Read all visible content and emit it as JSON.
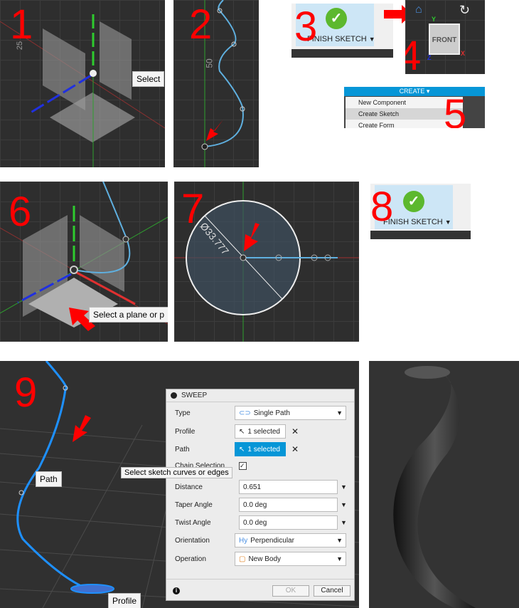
{
  "steps": {
    "s1": {
      "num": "1",
      "tooltip": "Select",
      "dim": "25"
    },
    "s2": {
      "num": "2",
      "dim": "50"
    },
    "s3": {
      "num": "3",
      "finish_label": "FINISH SKETCH",
      "dropdown": "▼"
    },
    "s4": {
      "num": "4",
      "cube_face": "FRONT",
      "axis_y": "Y",
      "axis_x": "X",
      "axis_z": "Z",
      "home_icon": "home-icon"
    },
    "s5": {
      "num": "5",
      "menu_title": "CREATE ▾",
      "items": [
        "New Component",
        "Create Sketch",
        "Create Form"
      ]
    },
    "s6": {
      "num": "6",
      "tooltip": "Select a plane or p"
    },
    "s7": {
      "num": "7",
      "dim": "Ø33.777"
    },
    "s8": {
      "num": "8",
      "finish_label": "FINISH SKETCH",
      "dropdown": "▼"
    },
    "s9": {
      "num": "9",
      "path_label": "Path",
      "profile_label": "Profile",
      "tooltip": "Select sketch curves or edges"
    }
  },
  "sweep": {
    "title": "SWEEP",
    "type_label": "Type",
    "type_value": "Single Path",
    "profile_label": "Profile",
    "profile_value": "1 selected",
    "path_label": "Path",
    "path_value": "1 selected",
    "chain_label": "Chain Selection",
    "chain_checked": true,
    "distance_label": "Distance",
    "distance_value": "0.651",
    "taper_label": "Taper Angle",
    "taper_value": "0.0 deg",
    "twist_label": "Twist Angle",
    "twist_value": "0.0 deg",
    "orientation_label": "Orientation",
    "orientation_value": "Perpendicular",
    "operation_label": "Operation",
    "operation_value": "New Body",
    "ok": "OK",
    "cancel": "Cancel",
    "clear": "✕"
  },
  "colors": {
    "accent": "#0696d7",
    "arrow": "#ff0000",
    "curve": "#5fb0e0",
    "check": "#5cb82e"
  }
}
